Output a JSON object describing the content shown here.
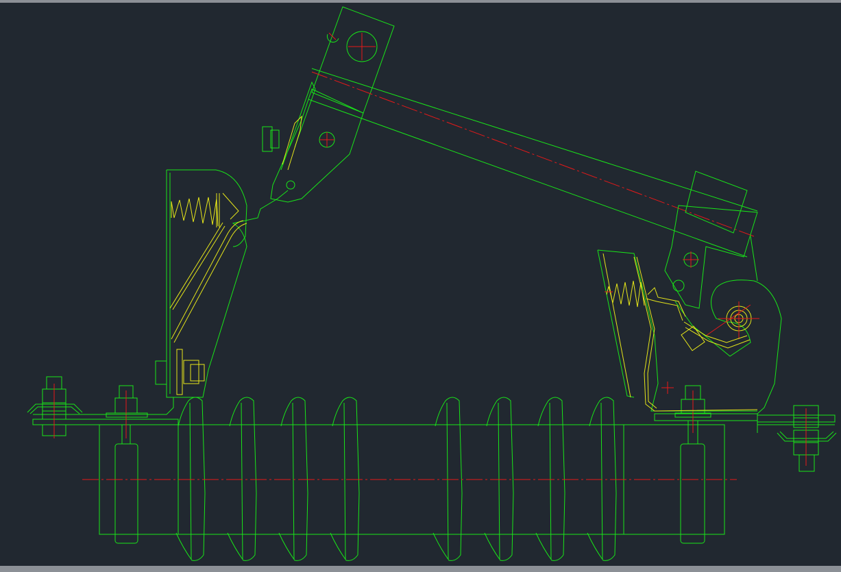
{
  "drawing": {
    "background_color": "#212830",
    "frame_color": "#8c9096",
    "line_colors": {
      "outline": "#19e619",
      "spring_and_contacts": "#e6e61a",
      "centerlines": "#e61919"
    },
    "insulator": {
      "shed_count": 8
    }
  }
}
